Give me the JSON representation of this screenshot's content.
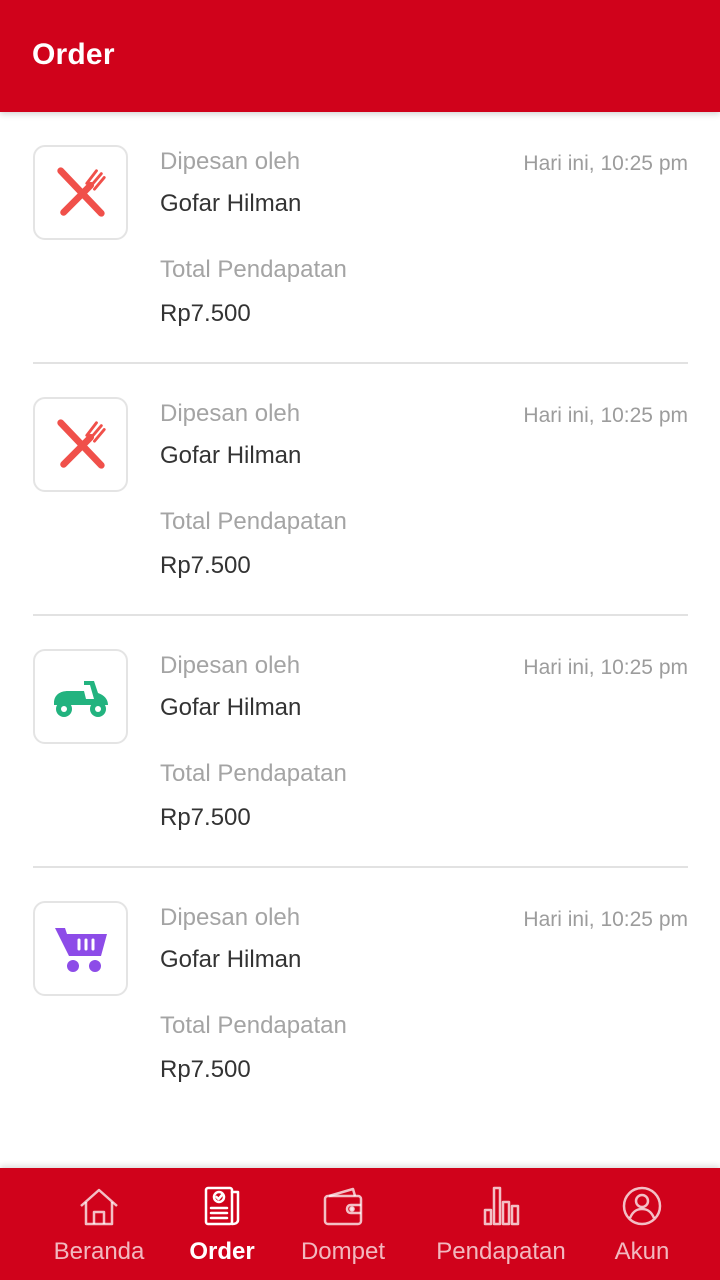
{
  "header": {
    "title": "Order"
  },
  "colors": {
    "brand_red": "#d0021b",
    "food_icon": "#f0504a",
    "ride_icon": "#22b37f",
    "shop_icon": "#8d4ce8"
  },
  "orders": [
    {
      "icon": "food-icon",
      "ordered_by_label": "Dipesan oleh",
      "customer": "Gofar Hilman",
      "time": "Hari ini, 10:25 pm",
      "income_label": "Total Pendapatan",
      "income": "Rp7.500"
    },
    {
      "icon": "food-icon",
      "ordered_by_label": "Dipesan oleh",
      "customer": "Gofar Hilman",
      "time": "Hari ini, 10:25 pm",
      "income_label": "Total Pendapatan",
      "income": "Rp7.500"
    },
    {
      "icon": "scooter-icon",
      "ordered_by_label": "Dipesan oleh",
      "customer": "Gofar Hilman",
      "time": "Hari ini, 10:25 pm",
      "income_label": "Total Pendapatan",
      "income": "Rp7.500"
    },
    {
      "icon": "shopping-cart-icon",
      "ordered_by_label": "Dipesan oleh",
      "customer": "Gofar Hilman",
      "time": "Hari ini, 10:25 pm",
      "income_label": "Total Pendapatan",
      "income": "Rp7.500"
    }
  ],
  "bottom_nav": {
    "active": "Order",
    "items": [
      {
        "label": "Beranda",
        "icon": "home-icon"
      },
      {
        "label": "Order",
        "icon": "order-list-icon"
      },
      {
        "label": "Dompet",
        "icon": "wallet-icon"
      },
      {
        "label": "Pendapatan",
        "icon": "bar-chart-icon"
      },
      {
        "label": "Akun",
        "icon": "account-icon"
      }
    ]
  }
}
